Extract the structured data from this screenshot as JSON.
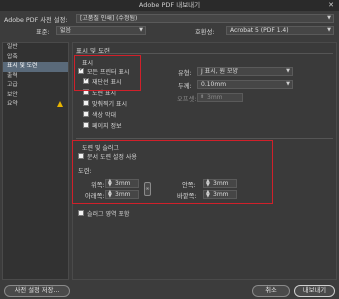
{
  "window": {
    "title": "Adobe PDF 내보내기"
  },
  "top": {
    "preset_label": "Adobe PDF 사전 설정:",
    "preset_value": "[고품질 인쇄] (수정됨)",
    "standard_label": "표준:",
    "standard_value": "없음",
    "compat_label": "호환성:",
    "compat_value": "Acrobat 5 (PDF 1.4)"
  },
  "sidebar": {
    "items": [
      {
        "label": "일반",
        "active": false
      },
      {
        "label": "압축",
        "active": false
      },
      {
        "label": "표시 및 도련",
        "active": true
      },
      {
        "label": "출력",
        "active": false
      },
      {
        "label": "고급",
        "active": false
      },
      {
        "label": "보안",
        "active": false
      },
      {
        "label": "요약",
        "active": false,
        "warning": true
      }
    ]
  },
  "panel": {
    "title": "표시 및 도련",
    "marks": {
      "title": "표시",
      "all_printer_marks": "모든 프린터 표시",
      "crop_marks": "재단선 표시",
      "bleed_marks": "도련 표시",
      "registration_marks": "맞춰찍기 표시",
      "color_bars": "색상 막대",
      "page_info": "페이지 정보",
      "type_label": "유형:",
      "type_value": "J 표시, 원 모양",
      "weight_label": "두께:",
      "weight_value": "0.10mm",
      "offset_label": "오프셋:",
      "offset_value": "3mm"
    },
    "bleed": {
      "title": "도련 및 슬러그",
      "use_doc_settings": "문서 도련 설정 사용",
      "bleed_label": "도련:",
      "top_label": "위쪽:",
      "top_value": "3mm",
      "bottom_label": "아래쪽:",
      "bottom_value": "3mm",
      "inside_label": "안쪽:",
      "inside_value": "3mm",
      "outside_label": "바깥쪽:",
      "outside_value": "3mm",
      "include_slug": "슬러그 영역 포함"
    }
  },
  "buttons": {
    "save_preset": "사전 설정 저장...",
    "cancel": "취소",
    "export": "내보내기"
  },
  "colors": {
    "highlight_box": "#d0202a",
    "active_sidebar": "#5a6a7a",
    "warning": "#e8b400"
  }
}
